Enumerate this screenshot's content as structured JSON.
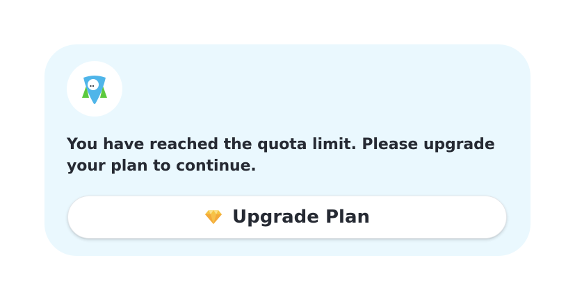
{
  "dialog": {
    "message": "You have reached the quota limit. Please upgrade your plan to continue.",
    "upgrade_button": {
      "label": "Upgrade Plan",
      "icon": "gem-icon"
    },
    "avatar_icon": "mascot-icon"
  },
  "colors": {
    "card_background": "#eaf8fe",
    "button_background": "#ffffff",
    "text": "#262a33",
    "mascot_blue": "#4fb5e9",
    "mascot_green": "#5cc93e",
    "gem_gold": "#f6c342"
  }
}
